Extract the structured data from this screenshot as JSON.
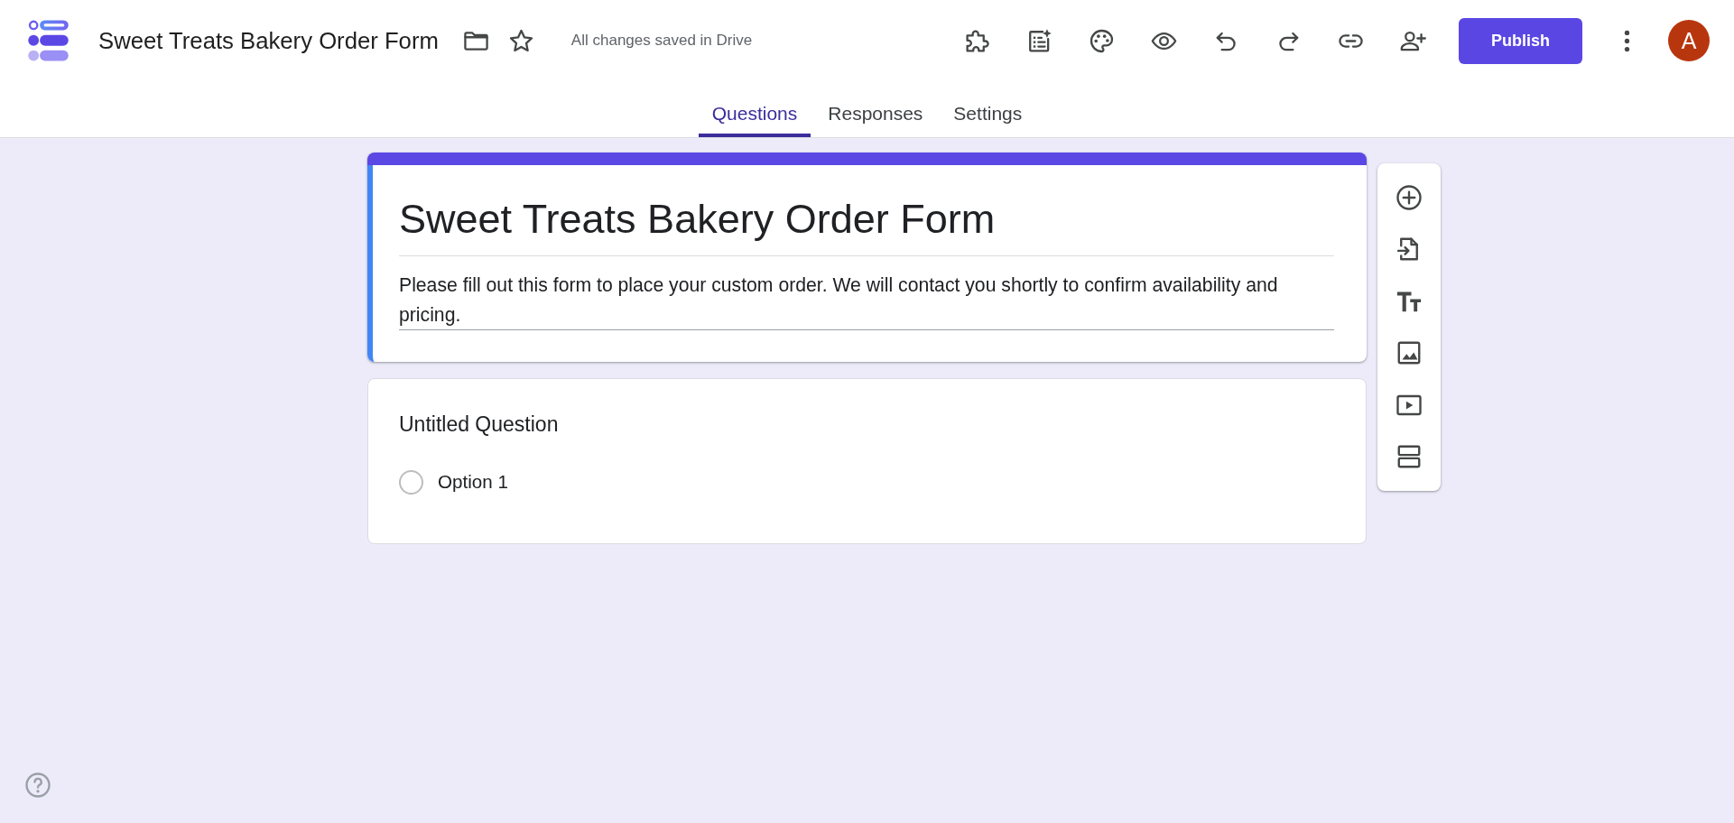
{
  "header": {
    "title": "Sweet Treats Bakery Order Form",
    "starred": false,
    "save_status": "All changes saved in Drive",
    "publish_label": "Publish",
    "avatar_initial": "A"
  },
  "tabs": [
    {
      "label": "Questions",
      "selected": true
    },
    {
      "label": "Responses",
      "selected": false
    },
    {
      "label": "Settings",
      "selected": false
    }
  ],
  "form_header": {
    "title": "Sweet Treats Bakery Order Form",
    "description": "Please fill out this form to place your custom order. We will contact you shortly to confirm availability and pricing."
  },
  "questions": [
    {
      "kind": "multiple_choice",
      "title": "Untitled Question",
      "options": [
        {
          "label": "Option 1",
          "selected": false
        }
      ]
    }
  ]
}
